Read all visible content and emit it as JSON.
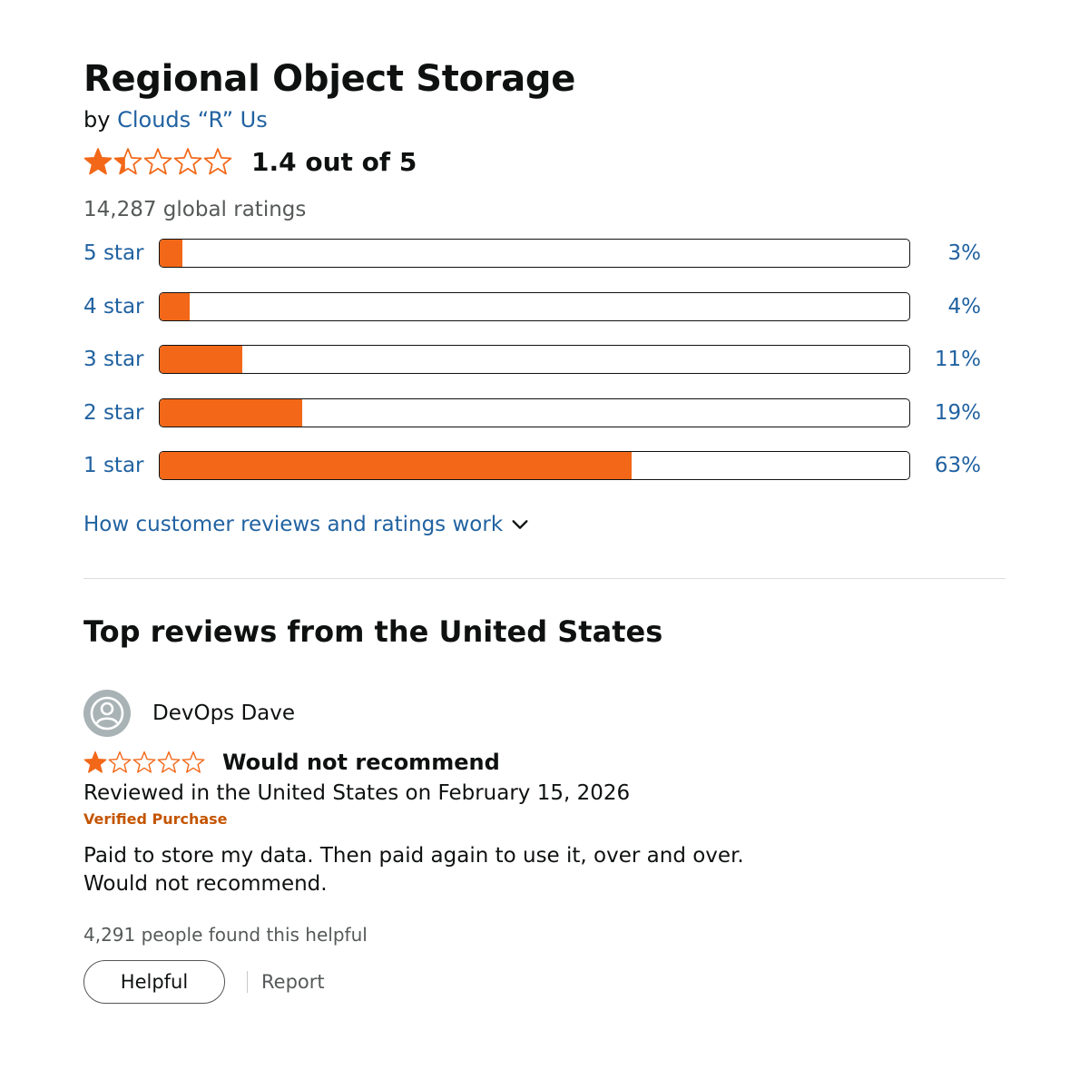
{
  "product": {
    "title": "Regional Object Storage",
    "by_prefix": "by",
    "brand": "Clouds “R” Us"
  },
  "rating": {
    "stars_filled": 1.4,
    "average_label": "1.4 out of 5",
    "global_ratings": "14,287 global ratings"
  },
  "histogram": [
    {
      "label": "5 star",
      "percent_label": "3%",
      "percent": 3
    },
    {
      "label": "4 star",
      "percent_label": "4%",
      "percent": 4
    },
    {
      "label": "3 star",
      "percent_label": "11%",
      "percent": 11
    },
    {
      "label": "2 star",
      "percent_label": "19%",
      "percent": 19
    },
    {
      "label": "1 star",
      "percent_label": "63%",
      "percent": 63
    }
  ],
  "how_link": "How customer reviews and ratings work",
  "section_title": "Top reviews from the United States",
  "review": {
    "reviewer": "DevOps Dave",
    "stars": 1,
    "title": "Would not recommend",
    "date": "Reviewed in the United States on February 15, 2026",
    "verified": "Verified Purchase",
    "body_line1": "Paid to store my data. Then paid again to use it, over and over.",
    "body_line2": "Would not recommend.",
    "helpful_count": "4,291 people found this helpful",
    "helpful_button": "Helpful",
    "report_link": "Report"
  },
  "colors": {
    "star": "#f26818",
    "bar_fill": "#f26818",
    "link": "#2162a1",
    "verified": "#c45500",
    "avatar_bg": "#a9b3b6"
  },
  "icons": {
    "star": "star-icon",
    "chevron": "chevron-down-icon",
    "avatar": "user-avatar-icon"
  }
}
